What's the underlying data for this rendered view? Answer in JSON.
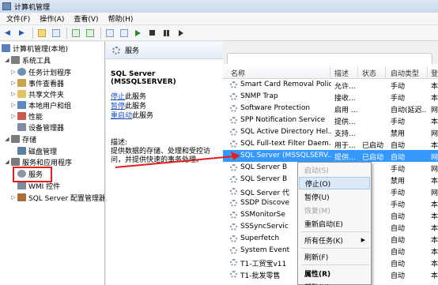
{
  "window": {
    "title": "计算机管理"
  },
  "menu": [
    "文件(F)",
    "操作(A)",
    "查看(V)",
    "帮助(H)"
  ],
  "toolbar": [
    "back-icon",
    "forward-icon",
    "folder-icon",
    "console-tree-icon",
    "refresh-icon",
    "export-icon",
    "help-icon",
    "properties-icon",
    "start-icon",
    "stop-icon",
    "pause-icon",
    "restart-icon"
  ],
  "tree": {
    "items": [
      {
        "label": "计算机管理(本地)",
        "icon": "computer-icon",
        "color": "#5b7fb8"
      },
      {
        "label": "系统工具",
        "icon": "tools-icon",
        "color": "#7d7d7d"
      },
      {
        "label": "任务计划程序",
        "icon": "clock-icon",
        "color": "#6f8fb8"
      },
      {
        "label": "事件查看器",
        "icon": "event-icon",
        "color": "#c9a24a"
      },
      {
        "label": "共享文件夹",
        "icon": "folder-icon",
        "color": "#e3c464"
      },
      {
        "label": "本地用户和组",
        "icon": "users-icon",
        "color": "#5d8ac0"
      },
      {
        "label": "性能",
        "icon": "performance-icon",
        "color": "#c85a4a"
      },
      {
        "label": "设备管理器",
        "icon": "device-icon",
        "color": "#7d8ea3"
      },
      {
        "label": "存储",
        "icon": "storage-icon",
        "color": "#7a7a7a"
      },
      {
        "label": "磁盘管理",
        "icon": "disk-icon",
        "color": "#5d7fa6"
      },
      {
        "label": "服务和应用程序",
        "icon": "services-app-icon",
        "color": "#7a7a7a"
      },
      {
        "label": "服务",
        "icon": "services-icon",
        "color": "#8a96a6"
      },
      {
        "label": "WMI 控件",
        "icon": "wmi-icon",
        "color": "#7c8da3"
      },
      {
        "label": "SQL Server 配置管理器",
        "icon": "sql-icon",
        "color": "#b06a3a"
      }
    ]
  },
  "middle": {
    "header": "服务",
    "service_name": "SQL Server (MSSQLSERVER)",
    "links": [
      {
        "verb": "停止",
        "rest": "此服务"
      },
      {
        "verb": "暂停",
        "rest": "此服务"
      },
      {
        "verb": "重启动",
        "rest": "此服务"
      }
    ],
    "desc_label": "描述:",
    "desc_text": "提供数据的存储、处理和受控访问，并提供快速的事务处理。"
  },
  "list": {
    "columns": [
      "名称",
      "描述",
      "状态",
      "启动类型",
      "登"
    ],
    "rows": [
      {
        "name": "Smart Card Removal Policy",
        "desc": "允许...",
        "status": "",
        "startup": "手动",
        "logon": "本"
      },
      {
        "name": "SNMP Trap",
        "desc": "接收...",
        "status": "",
        "startup": "手动",
        "logon": "本"
      },
      {
        "name": "Software Protection",
        "desc": "启用 ...",
        "status": "",
        "startup": "自动(延迟...",
        "logon": "网"
      },
      {
        "name": "SPP Notification Service",
        "desc": "提供...",
        "status": "",
        "startup": "手动",
        "logon": "本"
      },
      {
        "name": "SQL Active Directory Hel...",
        "desc": "支持...",
        "status": "",
        "startup": "禁用",
        "logon": "网"
      },
      {
        "name": "SQL Full-text Filter Daem...",
        "desc": "用于...",
        "status": "已启动",
        "startup": "自动",
        "logon": "本"
      },
      {
        "name": "SQL Server (MSSQLSERV...",
        "desc": "提供...",
        "status": "已启动",
        "startup": "自动",
        "logon": "网"
      },
      {
        "name": "SQL Server B",
        "desc": "",
        "status": "",
        "startup": "手动",
        "logon": "网"
      },
      {
        "name": "SQL Server B",
        "desc": "",
        "status": "",
        "startup": "禁用",
        "logon": "本"
      },
      {
        "name": "SQL Server 代",
        "desc": "",
        "status": "",
        "startup": "手动",
        "logon": "网"
      },
      {
        "name": "SSDP Discove",
        "desc": "",
        "status": "",
        "startup": "手动",
        "logon": "本"
      },
      {
        "name": "SSMonitorSe",
        "desc": "",
        "status": "",
        "startup": "自动",
        "logon": "本"
      },
      {
        "name": "SSSyncServic",
        "desc": "",
        "status": "",
        "startup": "自动",
        "logon": "本"
      },
      {
        "name": "Superfetch",
        "desc": "",
        "status": "",
        "startup": "自动",
        "logon": "本"
      },
      {
        "name": "System Event",
        "desc": "",
        "status": "",
        "startup": "自动",
        "logon": "本"
      },
      {
        "name": "T1-工贸宝v11",
        "desc": "",
        "status": "",
        "startup": "自动",
        "logon": "本"
      },
      {
        "name": "T1-批发零售",
        "desc": "",
        "status": "",
        "startup": "自动",
        "logon": "本"
      }
    ],
    "selected_row": 6
  },
  "context_menu": {
    "items": [
      {
        "label": "启动(S)",
        "disabled": true
      },
      {
        "label": "停止(O)",
        "highlight": true
      },
      {
        "label": "暂停(U)"
      },
      {
        "label": "恢复(M)",
        "disabled": true
      },
      {
        "label": "重新启动(E)"
      },
      {
        "label": "所有任务(K)",
        "submenu": true
      },
      {
        "label": "刷新(F)"
      },
      {
        "label": "属性(R)",
        "bold": true
      },
      {
        "label": "帮助(H)"
      }
    ]
  },
  "colors": {
    "selection": "#3399ff",
    "highlight_box": "#e02020",
    "link": "#1a4fbf"
  }
}
